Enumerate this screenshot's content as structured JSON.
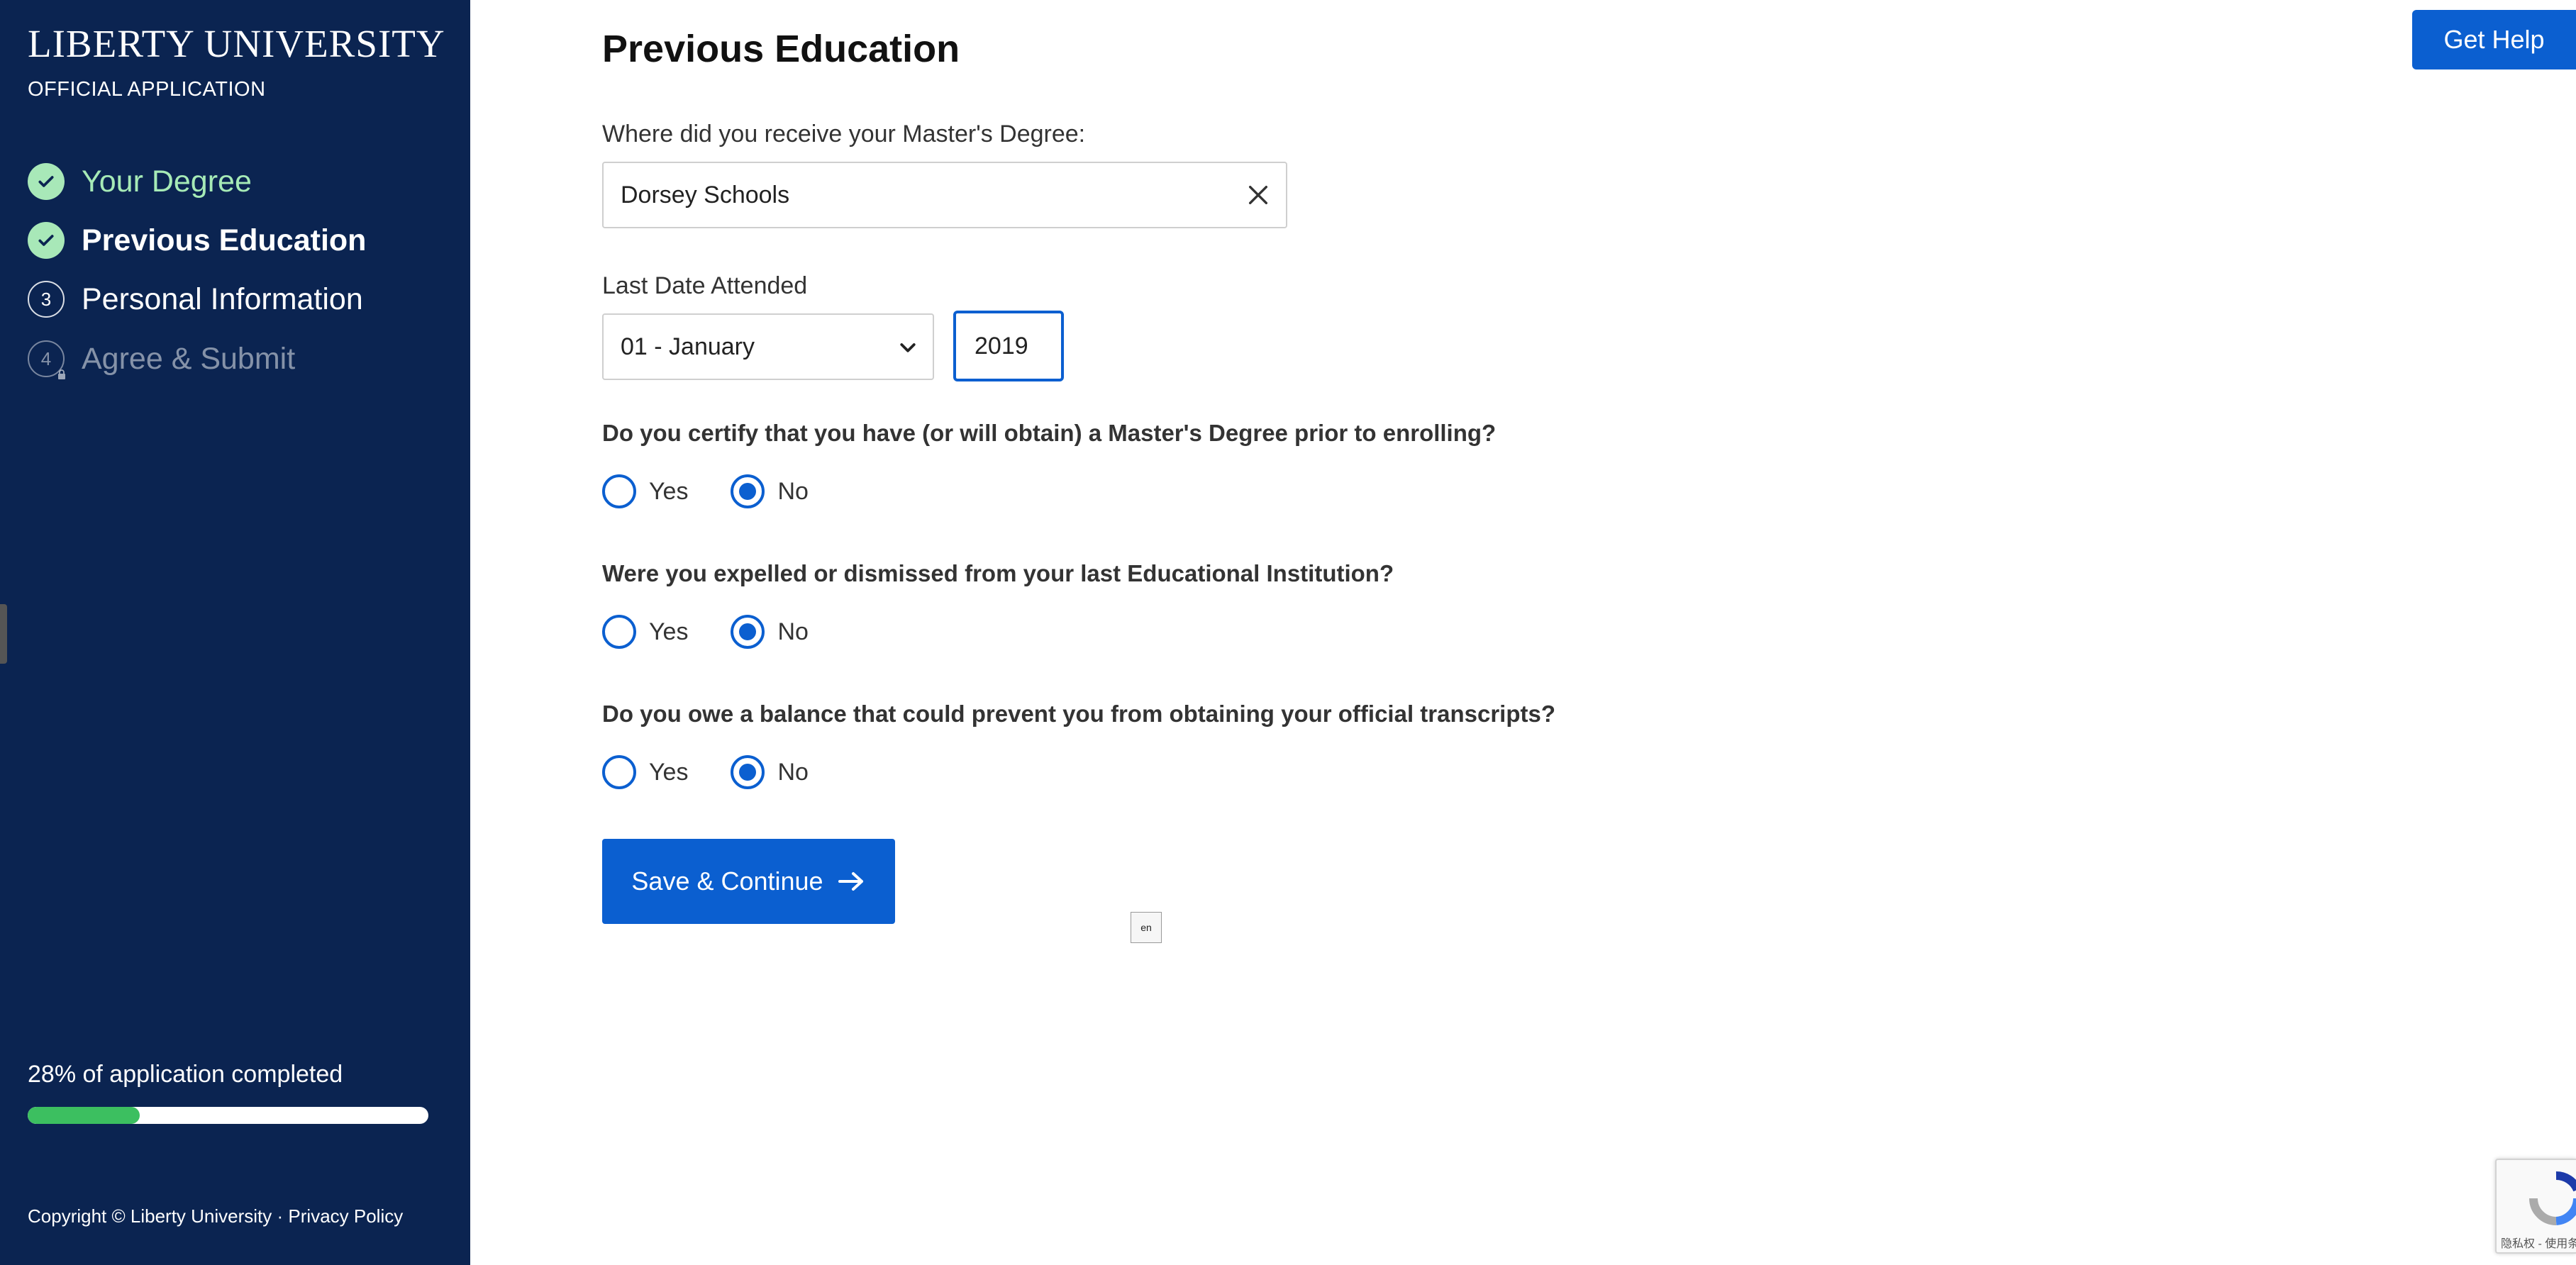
{
  "sidebar": {
    "brand": "LIBERTY UNIVERSITY",
    "subtitle": "OFFICIAL APPLICATION",
    "steps": [
      {
        "number": "1",
        "label": "Your Degree",
        "status": "complete"
      },
      {
        "number": "2",
        "label": "Previous Education",
        "status": "complete-current"
      },
      {
        "number": "3",
        "label": "Personal Information",
        "status": "upcoming"
      },
      {
        "number": "4",
        "label": "Agree & Submit",
        "status": "locked"
      }
    ],
    "progress": {
      "text": "28% of application completed",
      "percent": 28
    },
    "copyright": "Copyright © Liberty University",
    "separator": "·",
    "privacy_link": "Privacy Policy"
  },
  "header": {
    "help_label": "Get Help"
  },
  "main": {
    "title": "Previous Education",
    "school": {
      "label": "Where did you receive your Master's Degree:",
      "value": "Dorsey Schools"
    },
    "last_date": {
      "label": "Last Date Attended",
      "month": "01 - January",
      "year": "2019"
    },
    "questions": [
      {
        "text": "Do you certify that you have (or will obtain) a Master's Degree prior to enrolling?",
        "yes": "Yes",
        "no": "No",
        "selected": "No"
      },
      {
        "text": "Were you expelled or dismissed from your last Educational Institution?",
        "yes": "Yes",
        "no": "No",
        "selected": "No"
      },
      {
        "text": "Do you owe a balance that could prevent you from obtaining your official transcripts?",
        "yes": "Yes",
        "no": "No",
        "selected": "No"
      }
    ],
    "save_label": "Save & Continue"
  },
  "widgets": {
    "translate_label": "en",
    "recaptcha_text": "隐私权 - 使用条款"
  },
  "colors": {
    "sidebar_bg": "#0b2451",
    "accent": "#0b5fd0",
    "complete_green": "#a8e8b8",
    "progress_green": "#3cbf60"
  }
}
